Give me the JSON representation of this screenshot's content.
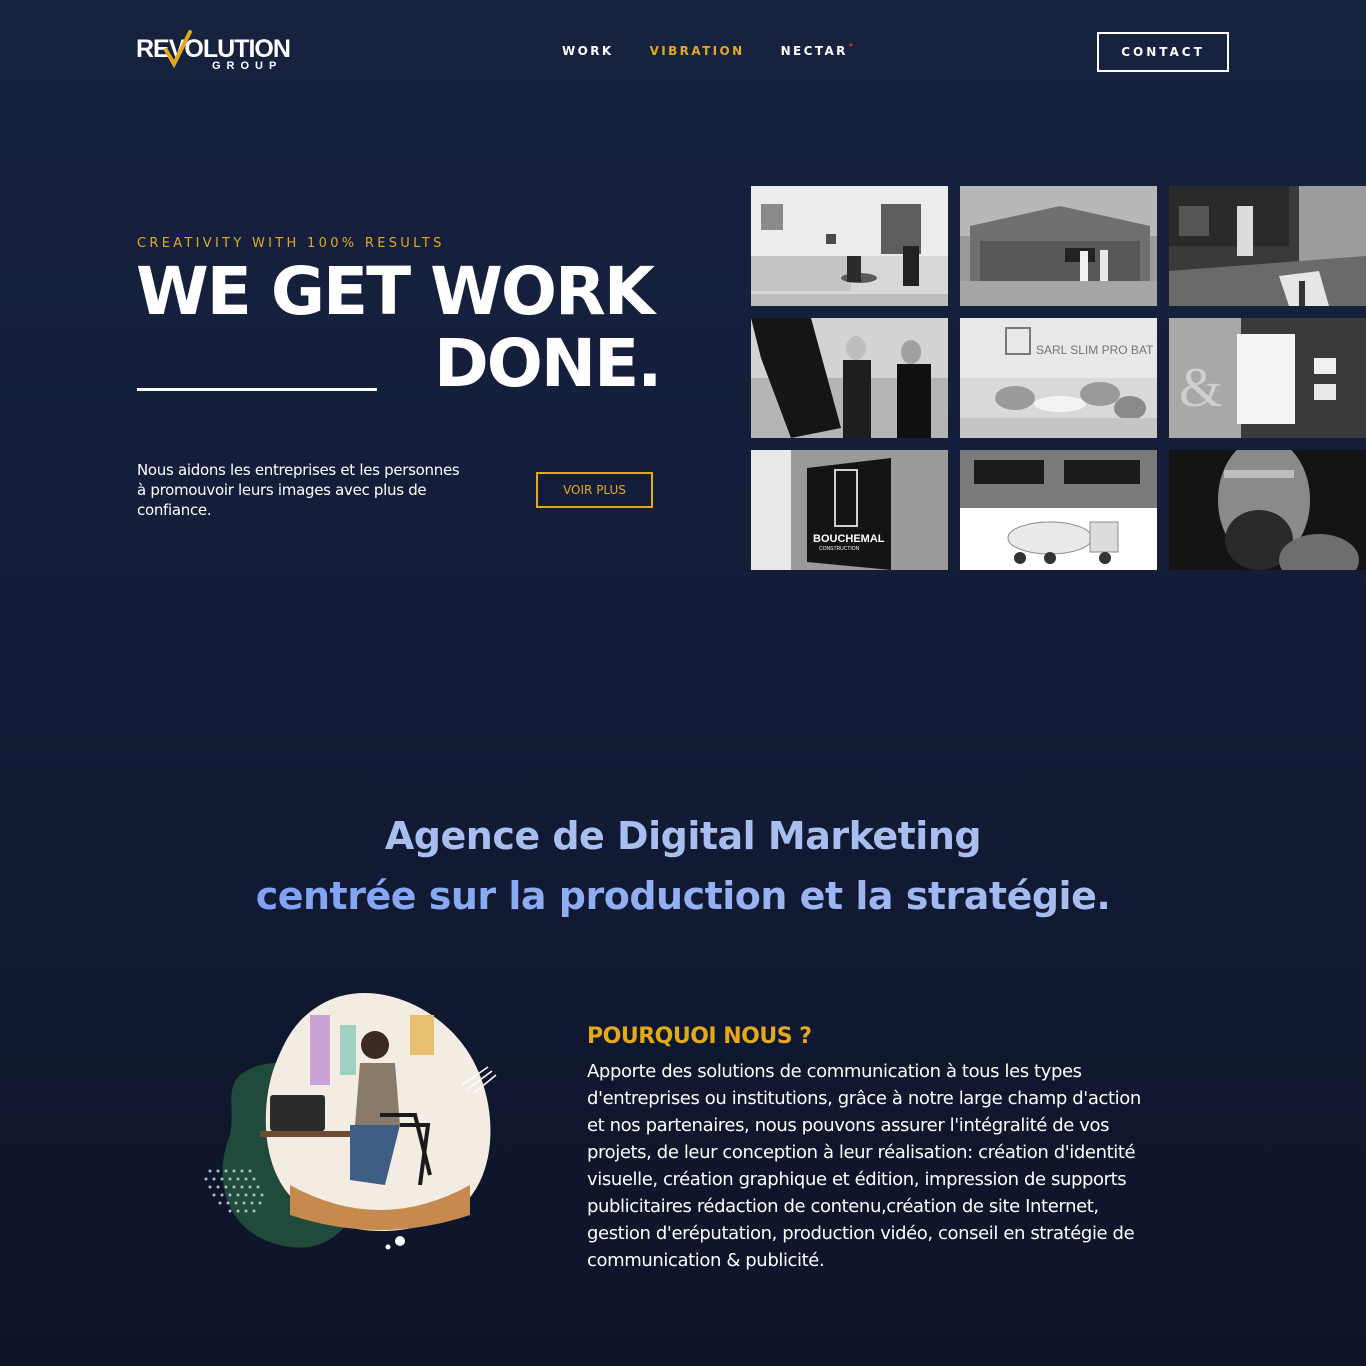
{
  "brand": {
    "logo_word": "REVOLUTION",
    "logo_sub": "GROUP",
    "accent_color": "#e2a91c",
    "background_color": "#17223f"
  },
  "nav": {
    "items": [
      {
        "label": "WORK",
        "active": false
      },
      {
        "label": "VIBRATION",
        "active": true
      },
      {
        "label": "NECTAR",
        "active": false,
        "badge": "*"
      }
    ],
    "contact_label": "CONTACT"
  },
  "hero": {
    "eyebrow": "CREATIVITY WITH 100% RESULTS",
    "headline_line1": "WE GET WORK",
    "headline_line2": "DONE.",
    "description": "Nous aidons les entreprises et les personnes à promouvoir leurs images avec plus de confiance.",
    "cta_label": "VOIR PLUS"
  },
  "gallery": {
    "tiles": [
      {
        "icon": "living-room-photo"
      },
      {
        "icon": "building-exterior-photo"
      },
      {
        "icon": "kitchen-photo"
      },
      {
        "icon": "fashion-models-photo"
      },
      {
        "icon": "office-lounge-photo",
        "caption": "SARL SLIM PRO BAT"
      },
      {
        "icon": "stationery-mockup-photo"
      },
      {
        "icon": "sign-mockup-photo",
        "caption": "BOUCHEMAL",
        "subcaption": "CONSTRUCTION"
      },
      {
        "icon": "truck-branding-photo"
      },
      {
        "icon": "portrait-photo"
      }
    ]
  },
  "agency": {
    "line1": "Agence de Digital Marketing",
    "line2": "centrée sur la production et la stratégie."
  },
  "why": {
    "title": "POURQUOI NOUS ?",
    "text": "Apporte des solutions de communication à tous les types d'entreprises ou institutions, grâce à notre large champ d'action et nos partenaires, nous pouvons assurer l'intégralité de vos projets, de leur conception à leur réalisation: création d'identité visuelle, création graphique et édition, impression de supports publicitaires rédaction de contenu,création de site Internet, gestion d'eréputation, production vidéo, conseil en stratégie de communication & publicité.",
    "illustration_icon": "workspace-illustration"
  }
}
